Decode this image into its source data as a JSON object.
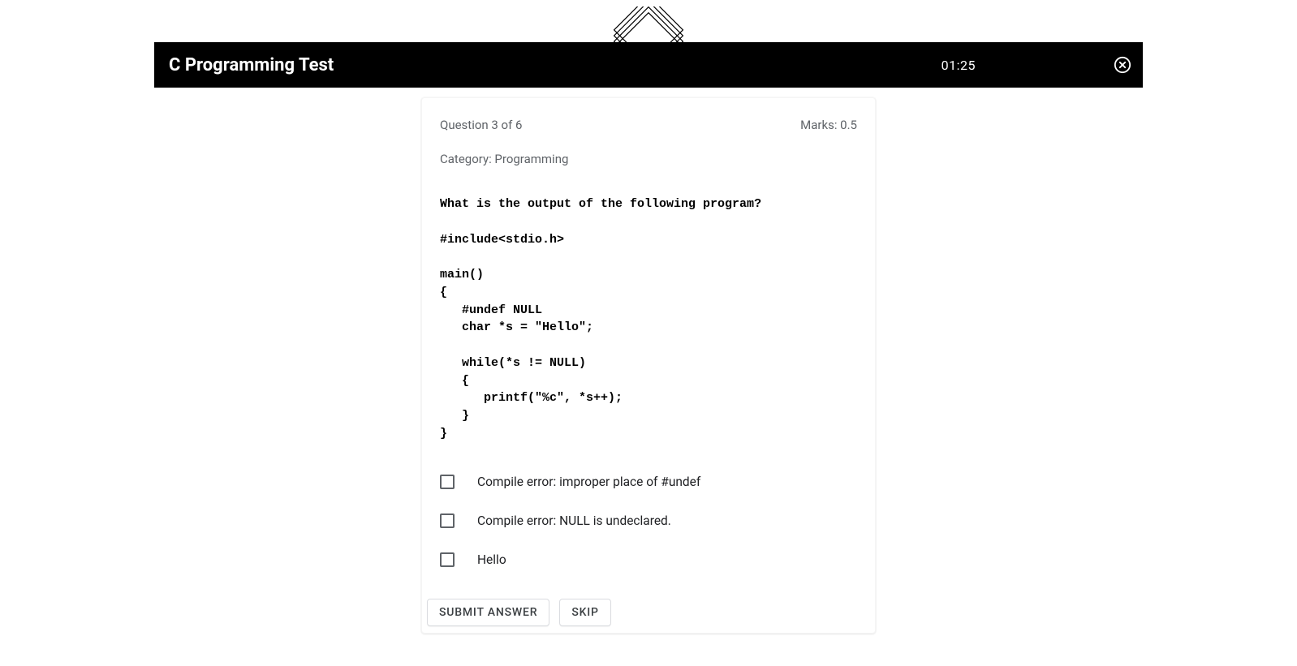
{
  "header": {
    "title": "C Programming Test",
    "timer": "01:25"
  },
  "question": {
    "progress": "Question 3 of 6",
    "marks": "Marks: 0.5",
    "category": "Category: Programming",
    "text": "What is the output of the following program?\n\n#include<stdio.h>\n\nmain()\n{ \n   #undef NULL\n   char *s = \"Hello\";\n   \n   while(*s != NULL)\n   {\n      printf(\"%c\", *s++);\n   }\n}"
  },
  "options": [
    {
      "label": "Compile error: improper place of #undef"
    },
    {
      "label": "Compile error: NULL is undeclared."
    },
    {
      "label": "Hello"
    }
  ],
  "buttons": {
    "submit": "Submit Answer",
    "skip": "Skip"
  }
}
